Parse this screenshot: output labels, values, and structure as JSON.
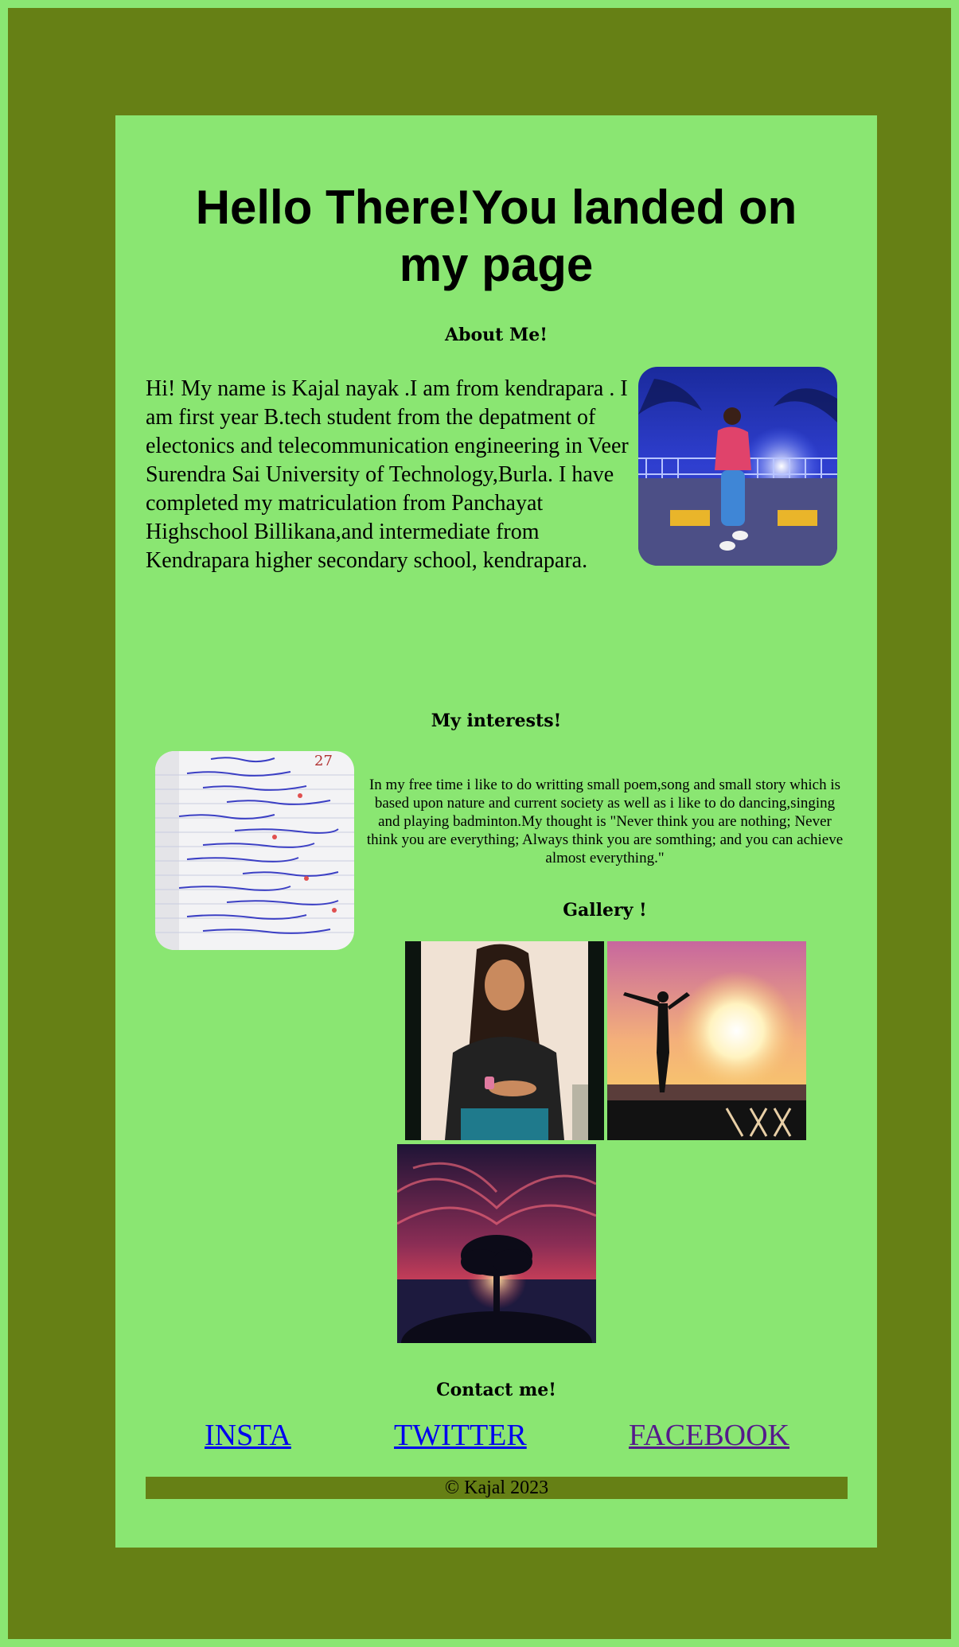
{
  "header": {
    "title": "Hello There!You landed on my page"
  },
  "about": {
    "heading": "About Me!",
    "text": "Hi! My name is Kajal nayak .I am from kendrapara . I am first year B.tech student from the depatment of electonics and telecommunication engineering in Veer Surendra Sai University of Technology,Burla. I have completed my matriculation from Panchayat Highschool Billikana,and intermediate from Kendrapara higher secondary school, kendrapara."
  },
  "interests": {
    "heading": "My interests!",
    "text": "In my free time i like to do writting small poem,song and small story which is based upon nature and current society as well as i like to do dancing,singing and playing badminton.My thought is \"Never think you are nothing; Never think you are everything; Always think you are somthing; and you can achieve almost everything.\"",
    "notebook_date": "27"
  },
  "gallery": {
    "heading": "Gallery !"
  },
  "contact": {
    "heading": "Contact me!",
    "links": [
      {
        "label": "INSTA",
        "color": "#0000ee"
      },
      {
        "label": "TWITTER",
        "color": "#0000ee"
      },
      {
        "label": "FACEBOOK",
        "color": "#551a8b"
      }
    ]
  },
  "footer": {
    "text": "© Kajal 2023"
  },
  "colors": {
    "outer_border": "#8ae672",
    "frame": "#668015",
    "panel": "#8ae672",
    "footer_bar": "#668015"
  }
}
